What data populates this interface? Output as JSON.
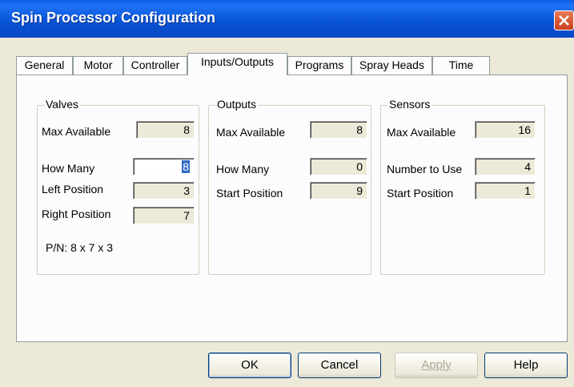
{
  "window": {
    "title": "Spin Processor Configuration"
  },
  "tabs": [
    {
      "label": "General"
    },
    {
      "label": "Motor"
    },
    {
      "label": "Controller"
    },
    {
      "label": "Inputs/Outputs"
    },
    {
      "label": "Programs"
    },
    {
      "label": "Spray Heads"
    },
    {
      "label": "Time"
    }
  ],
  "valves": {
    "legend": "Valves",
    "max_available_label": "Max Available",
    "max_available": "8",
    "how_many_label": "How Many",
    "how_many": "8",
    "left_position_label": "Left Position",
    "left_position": "3",
    "right_position_label": "Right Position",
    "right_position": "7",
    "pn_text": "P/N:  8 x 7 x 3"
  },
  "outputs": {
    "legend": "Outputs",
    "max_available_label": "Max Available",
    "max_available": "8",
    "how_many_label": "How Many",
    "how_many": "0",
    "start_position_label": "Start Position",
    "start_position": "9"
  },
  "sensors": {
    "legend": "Sensors",
    "max_available_label": "Max Available",
    "max_available": "16",
    "number_to_use_label": "Number to Use",
    "number_to_use": "4",
    "start_position_label": "Start Position",
    "start_position": "1"
  },
  "buttons": {
    "ok": "OK",
    "cancel": "Cancel",
    "apply": "Apply",
    "help": "Help"
  }
}
